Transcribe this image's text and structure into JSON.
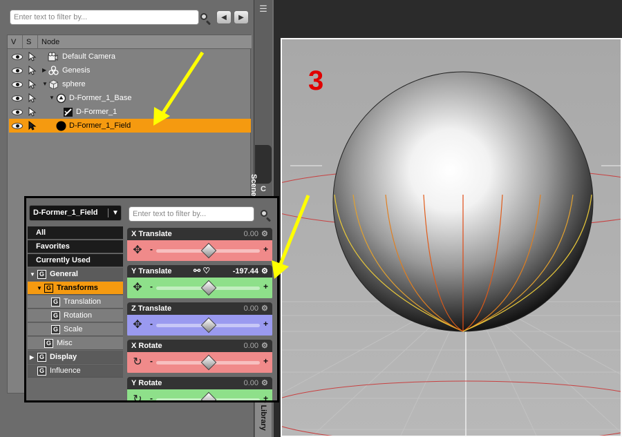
{
  "scene": {
    "filter_placeholder": "Enter text to filter by...",
    "columns": {
      "v": "V",
      "s": "S",
      "node": "Node"
    },
    "tab_label": "Scene",
    "second_tab_glyph": "C",
    "library_tab_label": "ar Library",
    "nodes": [
      {
        "label": "Default Camera",
        "icon": "camera-icon",
        "expander": ""
      },
      {
        "label": "Genesis",
        "icon": "figure-icon",
        "expander": "▶"
      },
      {
        "label": "sphere",
        "icon": "primitive-icon",
        "expander": "▼"
      },
      {
        "label": "D-Former_1_Base",
        "icon": "dformer-base-icon",
        "expander": "▼"
      },
      {
        "label": "D-Former_1",
        "icon": "dformer-icon",
        "expander": ""
      },
      {
        "label": "D-Former_1_Field",
        "icon": "field-icon",
        "expander": "",
        "selected": true
      }
    ]
  },
  "viewport": {
    "label_number": "3"
  },
  "parameters": {
    "node_selector": "D-Former_1_Field",
    "filter_placeholder": "Enter text to filter by...",
    "categories": [
      {
        "label": "All"
      },
      {
        "label": "Favorites"
      },
      {
        "label": "Currently Used"
      },
      {
        "label": "General",
        "icon": "G"
      },
      {
        "label": "Transforms",
        "icon": "G"
      },
      {
        "label": "Translation",
        "icon": "G"
      },
      {
        "label": "Rotation",
        "icon": "G"
      },
      {
        "label": "Scale",
        "icon": "G"
      },
      {
        "label": "Misc",
        "icon": "G"
      },
      {
        "label": "Display",
        "icon": "G"
      },
      {
        "label": "Influence",
        "icon": "G"
      }
    ],
    "sliders": [
      {
        "name": "X Translate",
        "value": "0.00",
        "color": "#f08a8a"
      },
      {
        "name": "Y Translate",
        "value": "-197.44",
        "color": "#8ee08a"
      },
      {
        "name": "Z Translate",
        "value": "0.00",
        "color": "#9a9af0"
      },
      {
        "name": "X Rotate",
        "value": "0.00",
        "color": "#f08a8a"
      },
      {
        "name": "Y Rotate",
        "value": "0.00",
        "color": "#8ee08a"
      }
    ]
  },
  "colors": {
    "selection": "#f59a10",
    "annotation_arrow": "#ffff00",
    "annotation_number": "#e00000"
  }
}
